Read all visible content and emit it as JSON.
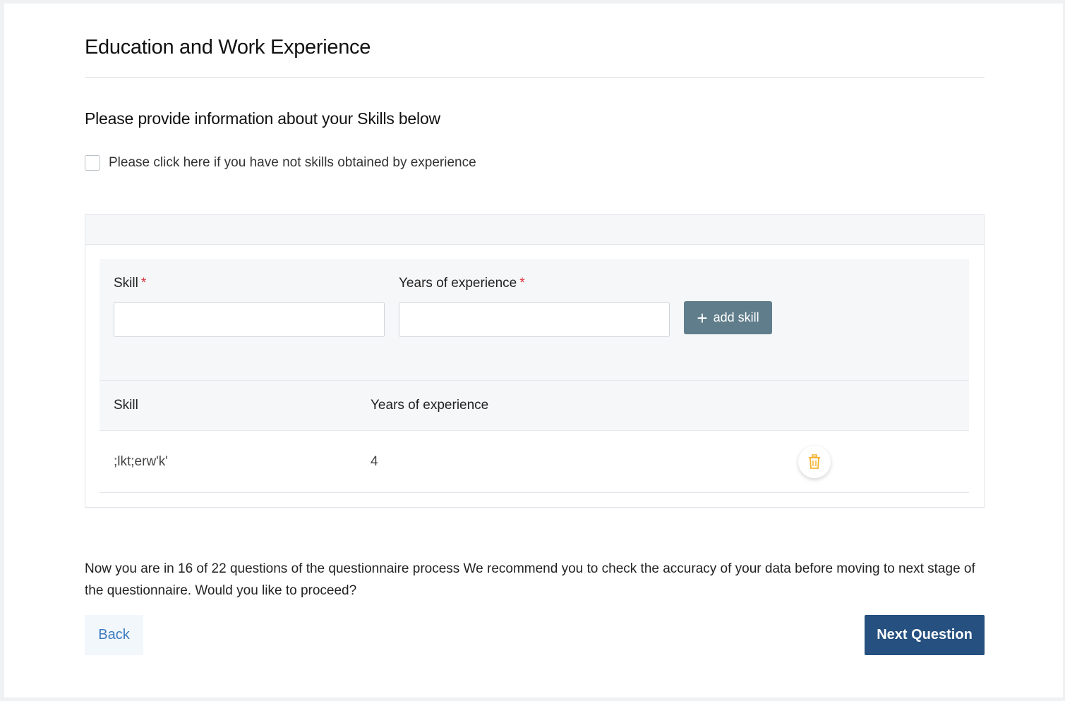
{
  "page": {
    "title": "Education and Work Experience"
  },
  "skills_section": {
    "heading": "Please provide information about your Skills below",
    "no_skills_checkbox_label": "Please click here if you have not skills obtained by experience",
    "no_skills_checked": false
  },
  "form": {
    "skill_label": "Skill",
    "years_label": "Years of experience",
    "required_marker": "*",
    "skill_value": "",
    "years_value": "",
    "add_button_label": "add skill",
    "add_button_icon": "plus-icon"
  },
  "table": {
    "columns": [
      "Skill",
      "Years of experience"
    ],
    "rows": [
      {
        "skill": ";lkt;erw'k'",
        "years": "4",
        "action_icon": "trash-icon"
      }
    ]
  },
  "footer": {
    "progress_text": "Now you are in 16 of 22 questions of the questionnaire process We recommend you to check the accuracy of your data before moving to next stage of the questionnaire. Would you like to proceed?",
    "back_label": "Back",
    "next_label": "Next Question"
  },
  "colors": {
    "add_button_bg": "#607d8b",
    "next_button_bg": "#25507f",
    "back_button_text": "#3a7bbf",
    "required_marker": "#e0323a",
    "trash_icon": "#f5b335"
  }
}
